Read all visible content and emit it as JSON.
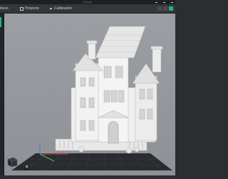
{
  "window": {
    "title": "Sin título"
  },
  "tabs": [
    {
      "label": "Inicio"
    },
    {
      "label": "Proyecto"
    },
    {
      "label": "Calibración"
    }
  ],
  "viewport": {
    "scene_object": "Victorian house model",
    "plate_color": "#2a2b2f",
    "model_color": "#eeeeee"
  },
  "icons": [
    "project-icon",
    "calibration-icon",
    "view-cube-icon",
    "close-icon"
  ]
}
